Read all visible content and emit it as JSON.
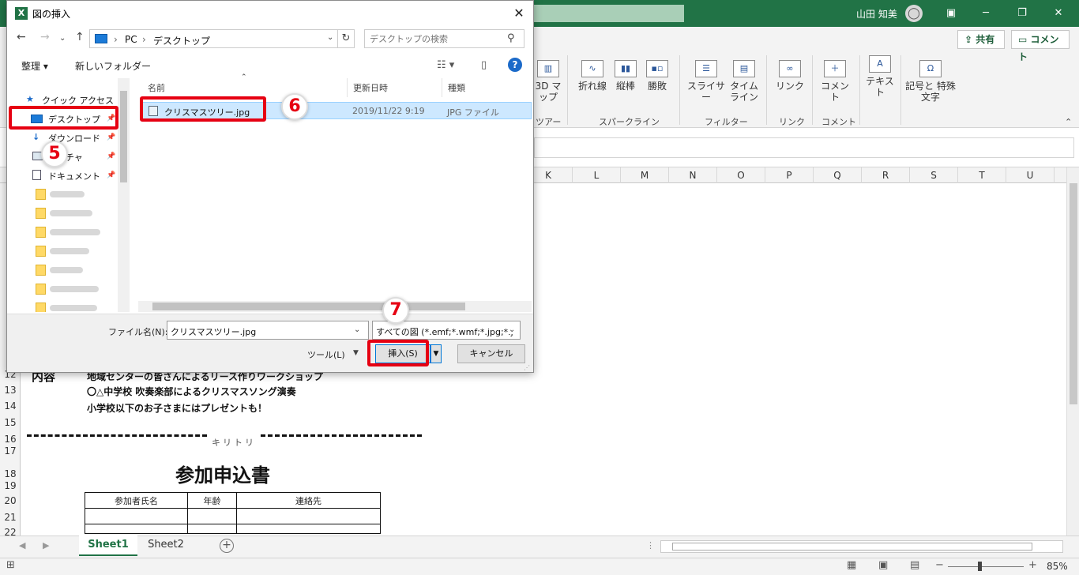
{
  "excel": {
    "user_name": "山田 知美",
    "share_label": "共有",
    "comment_label": "コメント",
    "ribbon": {
      "map_label": "3D マップ",
      "line_label": "折れ線",
      "column_label": "縦棒",
      "winloss_label": "勝敗",
      "slicer_label": "スライサー",
      "timeline_label": "タイム ライン",
      "link_label": "リンク",
      "comment_label": "コメント",
      "text_label": "テキスト",
      "symbol_label": "記号と 特殊文字",
      "group_tour": "ツアー",
      "group_sparkline": "スパークライン",
      "group_filter": "フィルター",
      "group_link": "リンク",
      "group_comment": "コメント"
    },
    "columns": [
      "K",
      "L",
      "M",
      "N",
      "O",
      "P",
      "Q",
      "R",
      "S",
      "T",
      "U"
    ],
    "rows": [
      "12",
      "13",
      "14",
      "15",
      "16",
      "17",
      "18",
      "19",
      "20",
      "21",
      "22"
    ],
    "cells": {
      "row12_label": "内容",
      "row12_text": "地域センターの皆さんによるリース作りワークショップ",
      "row13_text": "〇△中学校 吹奏楽部によるクリスマスソング演奏",
      "row14_text": "小学校以下のお子さまにはプレゼントも！",
      "kiritori": "キリトリ",
      "form_title": "参加申込書",
      "table_headers": [
        "参加者氏名",
        "年齢",
        "連絡先"
      ]
    },
    "sheets": [
      "Sheet1",
      "Sheet2"
    ],
    "zoom_level": "85%"
  },
  "dialog": {
    "title": "図の挿入",
    "breadcrumb": [
      "PC",
      "デスクトップ"
    ],
    "search_placeholder": "デスクトップの検索",
    "organize_label": "整理",
    "new_folder_label": "新しいフォルダー",
    "nav": {
      "quick_access": "クイック アクセス",
      "desktop": "デスクトップ",
      "downloads": "ダウンロード",
      "pictures": "ピクチャ",
      "documents": "ドキュメント"
    },
    "columns": {
      "name": "名前",
      "date": "更新日時",
      "type": "種類"
    },
    "file": {
      "name": "クリスマスツリー.jpg",
      "date": "2019/11/22 9:19",
      "type": "JPG ファイル"
    },
    "filename_label": "ファイル名(N):",
    "filename_value": "クリスマスツリー.jpg",
    "filter_value": "すべての図 (*.emf;*.wmf;*.jpg;*.j",
    "tools_label": "ツール(L)",
    "insert_label": "挿入(S)",
    "cancel_label": "キャンセル"
  },
  "annotations": {
    "step5": "5",
    "step6": "6",
    "step7": "7",
    "color": "#e60012"
  }
}
